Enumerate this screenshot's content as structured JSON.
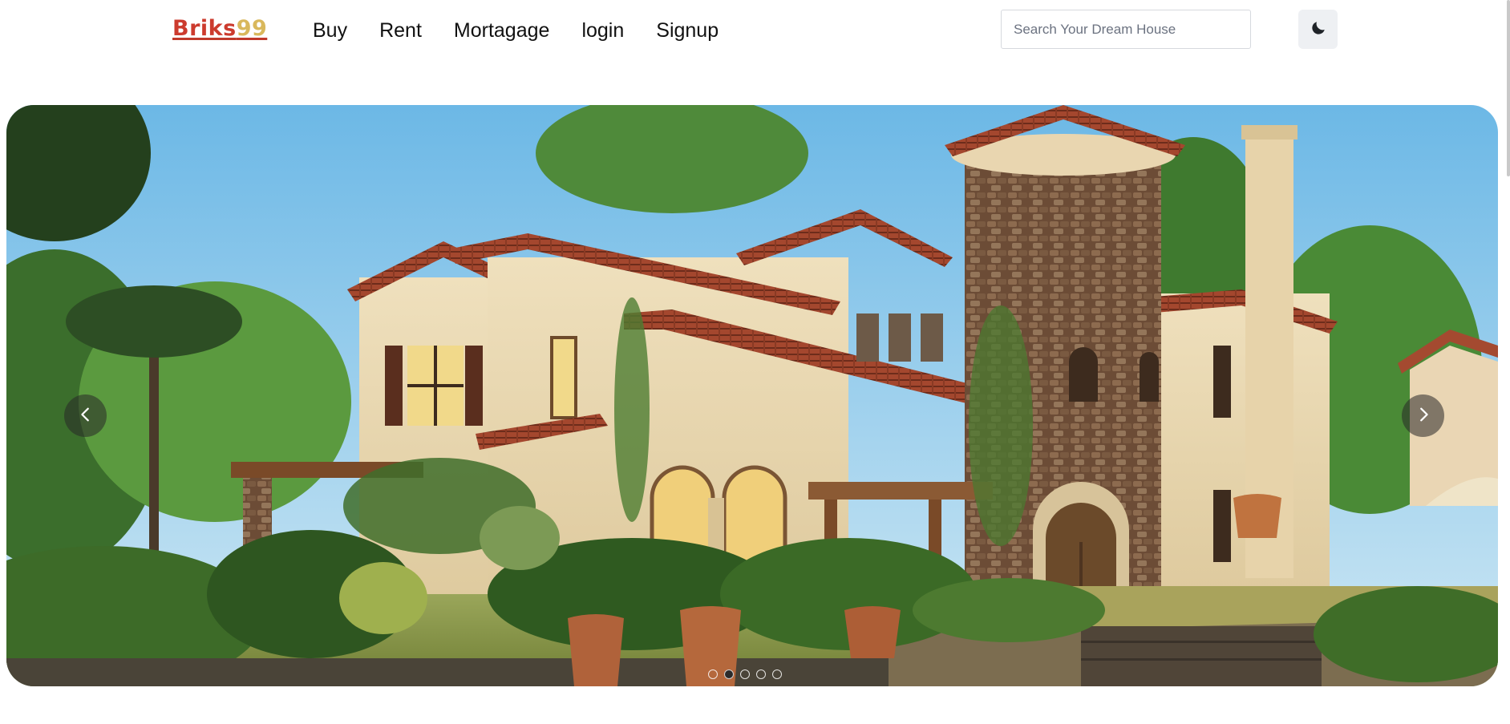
{
  "navbar": {
    "logo_main": "Briks",
    "logo_accent": "99",
    "links": [
      "Buy",
      "Rent",
      "Mortagage",
      "login",
      "Signup"
    ],
    "search_placeholder": "Search Your Dream House",
    "theme_toggle_icon": "moon-icon"
  },
  "carousel": {
    "slide_count": 5,
    "active_index": 1,
    "prev_icon": "chevron-left-icon",
    "next_icon": "chevron-right-icon"
  },
  "colors": {
    "logo_red": "#cc3b2e",
    "logo_gold": "#d9b85c",
    "toggle_bg": "#eef0f3",
    "search_border": "#d6d9de"
  }
}
